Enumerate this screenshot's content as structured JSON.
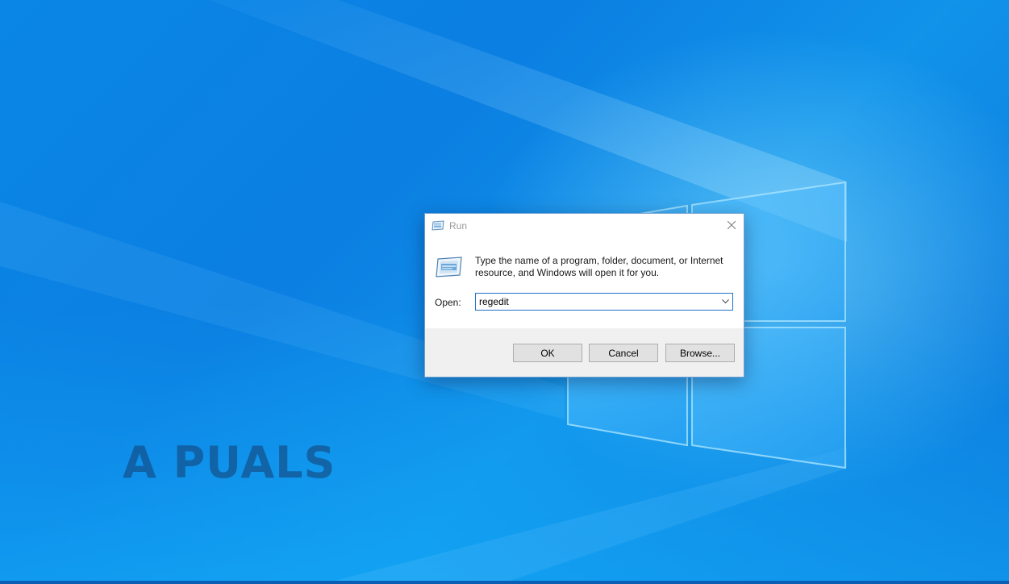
{
  "desktop": {
    "watermark_text": "A PUALS"
  },
  "run_dialog": {
    "title": "Run",
    "description": "Type the name of a program, folder, document, or Internet resource, and Windows will open it for you.",
    "open_label": "Open:",
    "open_value": "regedit",
    "buttons": {
      "ok": "OK",
      "cancel": "Cancel",
      "browse": "Browse..."
    }
  },
  "icons": {
    "title_icon": "run-icon",
    "close_icon": "close-icon",
    "big_icon": "run-icon",
    "dropdown_icon": "chevron-down-icon"
  },
  "colors": {
    "desktop_blue": "#0a7de0",
    "dialog_border": "#6d9fd1",
    "input_focus_border": "#1e6fc8",
    "footer_bg": "#f0f0f0",
    "button_bg": "#e1e1e1"
  }
}
